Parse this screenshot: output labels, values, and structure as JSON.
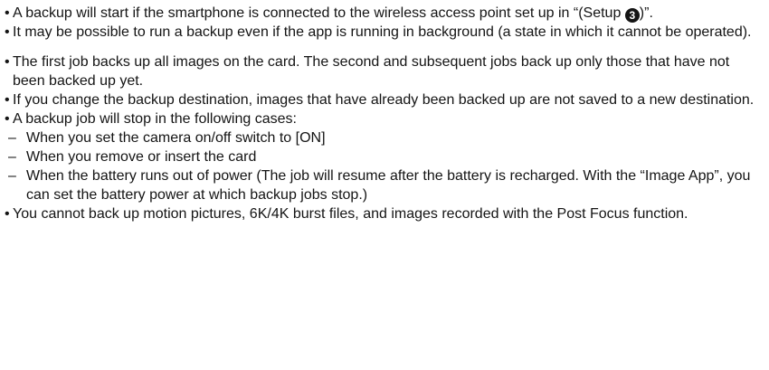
{
  "groups": [
    {
      "bullets": [
        {
          "pre": "A backup will start if the smartphone is connected to the wireless access point set up in “(Setup ",
          "circle": "3",
          "post": ")”."
        },
        {
          "text": "It may be possible to run a backup even if the app is running in background (a state in which it cannot be operated)."
        }
      ]
    },
    {
      "bullets": [
        {
          "text": "The first job backs up all images on the card. The second and subsequent jobs back up only those that have not been backed up yet."
        },
        {
          "text": "If you change the backup destination, images that have already been backed up are not saved to a new destination."
        },
        {
          "text": "A backup job will stop in the following cases:",
          "sub": [
            "When you set the camera on/off switch to [ON]",
            "When you remove or insert the card",
            "When the battery runs out of power (The job will resume after the battery is recharged. With the “Image App”, you can set the battery power at which backup jobs stop.)"
          ]
        },
        {
          "text": "You cannot back up motion pictures, 6K/4K burst files, and images recorded with the Post Focus function."
        }
      ]
    }
  ],
  "bullet_glyph": "•",
  "dash_glyph": "–"
}
